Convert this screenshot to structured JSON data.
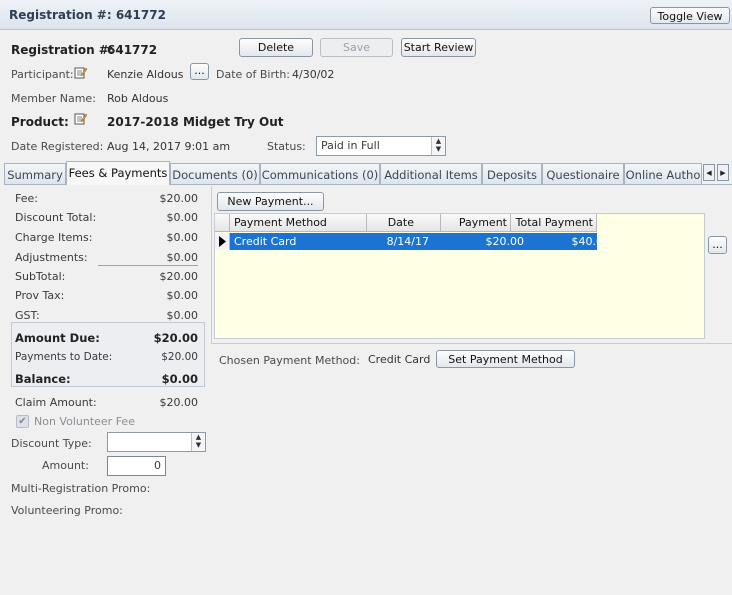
{
  "header": {
    "title": "Registration #: 641772",
    "toggle_view_label": "Toggle View"
  },
  "registration": {
    "label": "Registration #:",
    "value": "641772"
  },
  "actions": {
    "delete": "Delete",
    "save": "Save",
    "start_review": "Start Review"
  },
  "participant": {
    "label": "Participant:",
    "name": "Kenzie Aldous",
    "more_button": "...",
    "dob_label": "Date of Birth:",
    "dob_value": "4/30/02"
  },
  "member": {
    "label": "Member Name:",
    "name": "Rob Aldous"
  },
  "product": {
    "label": "Product:",
    "value": "2017-2018 Midget Try Out"
  },
  "date_registered": {
    "label": "Date Registered:",
    "value": "Aug 14, 2017 9:01 am"
  },
  "status": {
    "label": "Status:",
    "value": "Paid in Full"
  },
  "tabs": [
    {
      "label": "Summary"
    },
    {
      "label": "Fees & Payments"
    },
    {
      "label": "Documents (0)"
    },
    {
      "label": "Communications (0)"
    },
    {
      "label": "Additional Items"
    },
    {
      "label": "Deposits"
    },
    {
      "label": "Questionaire"
    },
    {
      "label": "Online Autho"
    }
  ],
  "fees": {
    "fee": {
      "label": "Fee:",
      "value": "$20.00"
    },
    "discount_total": {
      "label": "Discount Total:",
      "value": "$0.00"
    },
    "charge_items": {
      "label": "Charge Items:",
      "value": "$0.00"
    },
    "adjustments": {
      "label": "Adjustments:",
      "value": "$0.00"
    },
    "subtotal": {
      "label": "SubTotal:",
      "value": "$20.00"
    },
    "prov_tax": {
      "label": "Prov Tax:",
      "value": "$0.00"
    },
    "gst": {
      "label": "GST:",
      "value": "$0.00"
    },
    "amount_due": {
      "label": "Amount Due:",
      "value": "$20.00"
    },
    "payments_to_date": {
      "label": "Payments to Date:",
      "value": "$20.00"
    },
    "balance": {
      "label": "Balance:",
      "value": "$0.00"
    },
    "claim_amount": {
      "label": "Claim Amount:",
      "value": "$20.00"
    }
  },
  "non_volunteer_fee": {
    "label": "Non Volunteer Fee",
    "checked": true
  },
  "discount_type": {
    "label": "Discount Type:",
    "value": ""
  },
  "amount": {
    "label": "Amount:",
    "value": "0"
  },
  "multi_promo": {
    "label": "Multi-Registration Promo:"
  },
  "volunteer_promo": {
    "label": "Volunteering Promo:"
  },
  "payments": {
    "new_button": "New Payment...",
    "columns": [
      "Payment Method",
      "Date",
      "Payment",
      "Total Payment"
    ],
    "rows": [
      {
        "method": "Credit Card",
        "date": "8/14/17",
        "payment": "$20.00",
        "total": "$40.00"
      }
    ],
    "side_button": "...",
    "chosen_label": "Chosen Payment Method:",
    "chosen_value": "Credit Card",
    "set_button": "Set Payment Method"
  },
  "colors": {
    "selection": "#1b74d1",
    "grid_bg": "#ffffe6"
  }
}
